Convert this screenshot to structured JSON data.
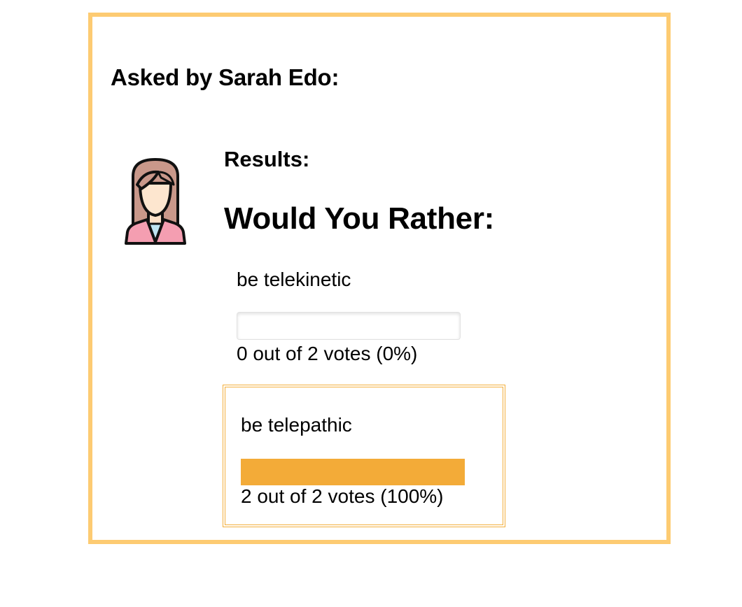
{
  "question": {
    "asked_by": "Asked by Sarah Edo:",
    "results_label": "Results:",
    "heading": "Would You Rather:",
    "avatar_icon": "woman-avatar-icon"
  },
  "options": [
    {
      "text": "be telekinetic",
      "votes_text": "0 out of 2 votes (0%)",
      "percent": 0,
      "selected": false
    },
    {
      "text": "be telepathic",
      "votes_text": "2 out of 2 votes (100%)",
      "percent": 100,
      "selected": true
    }
  ],
  "colors": {
    "card_border": "#fdcb72",
    "selected_border": "#f3ae3b",
    "progress_fill": "#f3ab38"
  }
}
